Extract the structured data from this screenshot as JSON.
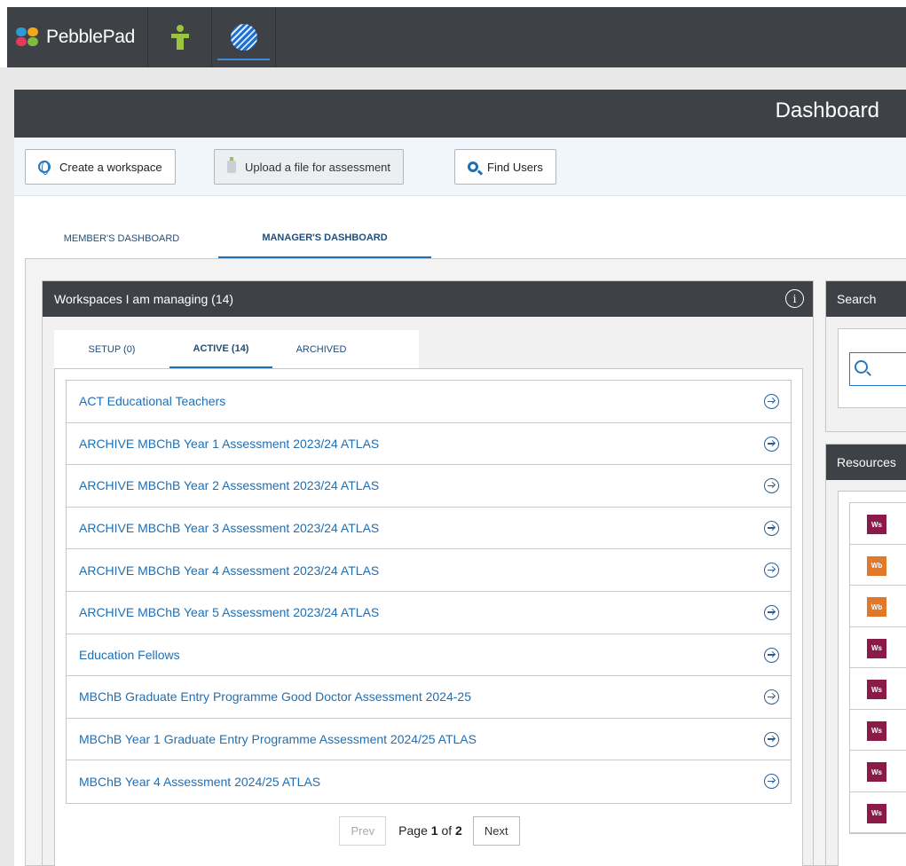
{
  "topbar": {
    "brand": "PebblePad",
    "apps": [
      {
        "icon": "person-icon",
        "color": "#9cc53f"
      },
      {
        "icon": "globe-icon",
        "color": "#1f6fd0"
      }
    ]
  },
  "header": {
    "title": "Dashboard"
  },
  "actions": {
    "create": "Create a workspace",
    "upload": "Upload a file for assessment",
    "find": "Find Users"
  },
  "dashboard_tabs": {
    "member": "MEMBER'S DASHBOARD",
    "manager": "MANAGER'S DASHBOARD"
  },
  "workspaces": {
    "title": "Workspaces I am managing (14)",
    "tabs": {
      "setup": "SETUP (0)",
      "active": "ACTIVE (14)",
      "archived": "ARCHIVED"
    },
    "items": [
      "ACT Educational Teachers",
      "ARCHIVE MBChB Year 1 Assessment 2023/24 ATLAS",
      "ARCHIVE MBChB Year 2 Assessment 2023/24 ATLAS",
      "ARCHIVE MBChB Year 3 Assessment 2023/24 ATLAS",
      "ARCHIVE MBChB Year 4 Assessment 2023/24 ATLAS",
      "ARCHIVE MBChB Year 5 Assessment 2023/24 ATLAS",
      "Education Fellows",
      "MBChB Graduate Entry Programme Good Doctor Assessment 2024-25",
      "MBChB Year 1 Graduate Entry Programme Assessment 2024/25 ATLAS",
      "MBChB Year 4 Assessment 2024/25 ATLAS"
    ],
    "pager": {
      "prev": "Prev",
      "page_prefix": "Page",
      "page_current": "1",
      "page_of": "of",
      "page_total": "2",
      "next": "Next"
    }
  },
  "search": {
    "title": "Search"
  },
  "resources": {
    "title": "Resources",
    "badges": [
      {
        "label": "Ws",
        "color": "#8b1a4a"
      },
      {
        "label": "Wb",
        "color": "#e07a2a"
      },
      {
        "label": "Wb",
        "color": "#e07a2a"
      },
      {
        "label": "Ws",
        "color": "#8b1a4a"
      },
      {
        "label": "Ws",
        "color": "#8b1a4a"
      },
      {
        "label": "Ws",
        "color": "#8b1a4a"
      },
      {
        "label": "Ws",
        "color": "#8b1a4a"
      },
      {
        "label": "Ws",
        "color": "#8b1a4a"
      }
    ]
  },
  "colors": {
    "accent": "#1f6fb4",
    "header_bg": "#3e4146"
  }
}
